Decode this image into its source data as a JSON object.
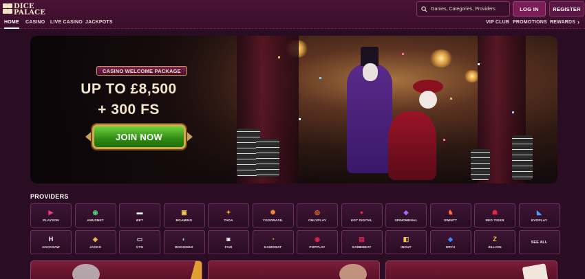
{
  "header": {
    "logo_line1": "DICE",
    "logo_line2": "PALACE",
    "search_placeholder": "Games, Categories, Providers",
    "login": "LOG IN",
    "register": "REGISTER",
    "nav_left": [
      "HOME",
      "CASINO",
      "LIVE CASINO",
      "JACKPOTS"
    ],
    "nav_right": [
      "VIP CLUB",
      "PROMOTIONS",
      "REWARDS"
    ],
    "nav_more_icon": "chevron-right-icon"
  },
  "hero": {
    "badge": "CASINO WELCOME PACKAGE",
    "line1": "UP TO £8,500",
    "line2": "+ 300 FS",
    "cta": "JOIN NOW"
  },
  "providers": {
    "title": "PROVIDERS",
    "items": [
      {
        "name": "PLAYSON",
        "icon": "▶",
        "color": "#e23c8c"
      },
      {
        "name": "AMUSNET",
        "icon": "◉",
        "color": "#4fd07a"
      },
      {
        "name": "BET",
        "icon": "▬",
        "color": "#ffffff"
      },
      {
        "name": "BGAMING",
        "icon": "▣",
        "color": "#f2c94c"
      },
      {
        "name": "TADA",
        "icon": "✦",
        "color": "#f2a13a"
      },
      {
        "name": "YGGDRASIL",
        "icon": "✺",
        "color": "#f08a3a"
      },
      {
        "name": "ONLYPLAY",
        "icon": "◎",
        "color": "#ff7a2a"
      },
      {
        "name": "EGT DIGITAL",
        "icon": "●",
        "color": "#e0244c"
      },
      {
        "name": "SPINOMENAL",
        "icon": "◆",
        "color": "#a56cff"
      },
      {
        "name": "SWINTT",
        "icon": "♞",
        "color": "#ff6a3a"
      },
      {
        "name": "RED TIGER",
        "icon": "☗",
        "color": "#e02a3a"
      },
      {
        "name": "EVOPLAY",
        "icon": "◣",
        "color": "#4aa0ff"
      },
      {
        "name": "HACKSAW",
        "icon": "H",
        "color": "#ffffff"
      },
      {
        "name": "JACKS",
        "icon": "◈",
        "color": "#f2c94c"
      },
      {
        "name": "CTG",
        "icon": "▭",
        "color": "#dddddd"
      },
      {
        "name": "BOOONGO",
        "icon": "◐",
        "color": "#7ad0e0"
      },
      {
        "name": "FAZI",
        "icon": "◙",
        "color": "#ffffff"
      },
      {
        "name": "GAMOMAT",
        "icon": "◔",
        "color": "#a8e04a"
      },
      {
        "name": "POPPLAY",
        "icon": "◉",
        "color": "#e0244c"
      },
      {
        "name": "GAMEBEAT",
        "icon": "▤",
        "color": "#e0244c"
      },
      {
        "name": "INOUT",
        "icon": "◧",
        "color": "#f2c94c"
      },
      {
        "name": "ORYX",
        "icon": "◆",
        "color": "#3a8aff"
      },
      {
        "name": "ZILLION",
        "icon": "Z",
        "color": "#f2c94c"
      },
      {
        "name": "SEE ALL",
        "icon": "",
        "color": "#ffffff"
      }
    ]
  }
}
